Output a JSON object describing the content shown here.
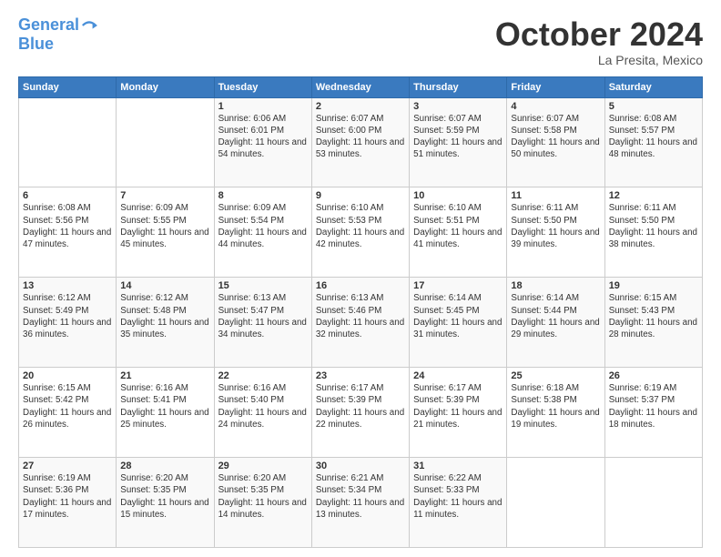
{
  "logo": {
    "line1": "General",
    "line2": "Blue"
  },
  "title": "October 2024",
  "location": "La Presita, Mexico",
  "weekdays": [
    "Sunday",
    "Monday",
    "Tuesday",
    "Wednesday",
    "Thursday",
    "Friday",
    "Saturday"
  ],
  "weeks": [
    [
      {
        "day": "",
        "info": ""
      },
      {
        "day": "",
        "info": ""
      },
      {
        "day": "1",
        "info": "Sunrise: 6:06 AM\nSunset: 6:01 PM\nDaylight: 11 hours and 54 minutes."
      },
      {
        "day": "2",
        "info": "Sunrise: 6:07 AM\nSunset: 6:00 PM\nDaylight: 11 hours and 53 minutes."
      },
      {
        "day": "3",
        "info": "Sunrise: 6:07 AM\nSunset: 5:59 PM\nDaylight: 11 hours and 51 minutes."
      },
      {
        "day": "4",
        "info": "Sunrise: 6:07 AM\nSunset: 5:58 PM\nDaylight: 11 hours and 50 minutes."
      },
      {
        "day": "5",
        "info": "Sunrise: 6:08 AM\nSunset: 5:57 PM\nDaylight: 11 hours and 48 minutes."
      }
    ],
    [
      {
        "day": "6",
        "info": "Sunrise: 6:08 AM\nSunset: 5:56 PM\nDaylight: 11 hours and 47 minutes."
      },
      {
        "day": "7",
        "info": "Sunrise: 6:09 AM\nSunset: 5:55 PM\nDaylight: 11 hours and 45 minutes."
      },
      {
        "day": "8",
        "info": "Sunrise: 6:09 AM\nSunset: 5:54 PM\nDaylight: 11 hours and 44 minutes."
      },
      {
        "day": "9",
        "info": "Sunrise: 6:10 AM\nSunset: 5:53 PM\nDaylight: 11 hours and 42 minutes."
      },
      {
        "day": "10",
        "info": "Sunrise: 6:10 AM\nSunset: 5:51 PM\nDaylight: 11 hours and 41 minutes."
      },
      {
        "day": "11",
        "info": "Sunrise: 6:11 AM\nSunset: 5:50 PM\nDaylight: 11 hours and 39 minutes."
      },
      {
        "day": "12",
        "info": "Sunrise: 6:11 AM\nSunset: 5:50 PM\nDaylight: 11 hours and 38 minutes."
      }
    ],
    [
      {
        "day": "13",
        "info": "Sunrise: 6:12 AM\nSunset: 5:49 PM\nDaylight: 11 hours and 36 minutes."
      },
      {
        "day": "14",
        "info": "Sunrise: 6:12 AM\nSunset: 5:48 PM\nDaylight: 11 hours and 35 minutes."
      },
      {
        "day": "15",
        "info": "Sunrise: 6:13 AM\nSunset: 5:47 PM\nDaylight: 11 hours and 34 minutes."
      },
      {
        "day": "16",
        "info": "Sunrise: 6:13 AM\nSunset: 5:46 PM\nDaylight: 11 hours and 32 minutes."
      },
      {
        "day": "17",
        "info": "Sunrise: 6:14 AM\nSunset: 5:45 PM\nDaylight: 11 hours and 31 minutes."
      },
      {
        "day": "18",
        "info": "Sunrise: 6:14 AM\nSunset: 5:44 PM\nDaylight: 11 hours and 29 minutes."
      },
      {
        "day": "19",
        "info": "Sunrise: 6:15 AM\nSunset: 5:43 PM\nDaylight: 11 hours and 28 minutes."
      }
    ],
    [
      {
        "day": "20",
        "info": "Sunrise: 6:15 AM\nSunset: 5:42 PM\nDaylight: 11 hours and 26 minutes."
      },
      {
        "day": "21",
        "info": "Sunrise: 6:16 AM\nSunset: 5:41 PM\nDaylight: 11 hours and 25 minutes."
      },
      {
        "day": "22",
        "info": "Sunrise: 6:16 AM\nSunset: 5:40 PM\nDaylight: 11 hours and 24 minutes."
      },
      {
        "day": "23",
        "info": "Sunrise: 6:17 AM\nSunset: 5:39 PM\nDaylight: 11 hours and 22 minutes."
      },
      {
        "day": "24",
        "info": "Sunrise: 6:17 AM\nSunset: 5:39 PM\nDaylight: 11 hours and 21 minutes."
      },
      {
        "day": "25",
        "info": "Sunrise: 6:18 AM\nSunset: 5:38 PM\nDaylight: 11 hours and 19 minutes."
      },
      {
        "day": "26",
        "info": "Sunrise: 6:19 AM\nSunset: 5:37 PM\nDaylight: 11 hours and 18 minutes."
      }
    ],
    [
      {
        "day": "27",
        "info": "Sunrise: 6:19 AM\nSunset: 5:36 PM\nDaylight: 11 hours and 17 minutes."
      },
      {
        "day": "28",
        "info": "Sunrise: 6:20 AM\nSunset: 5:35 PM\nDaylight: 11 hours and 15 minutes."
      },
      {
        "day": "29",
        "info": "Sunrise: 6:20 AM\nSunset: 5:35 PM\nDaylight: 11 hours and 14 minutes."
      },
      {
        "day": "30",
        "info": "Sunrise: 6:21 AM\nSunset: 5:34 PM\nDaylight: 11 hours and 13 minutes."
      },
      {
        "day": "31",
        "info": "Sunrise: 6:22 AM\nSunset: 5:33 PM\nDaylight: 11 hours and 11 minutes."
      },
      {
        "day": "",
        "info": ""
      },
      {
        "day": "",
        "info": ""
      }
    ]
  ]
}
